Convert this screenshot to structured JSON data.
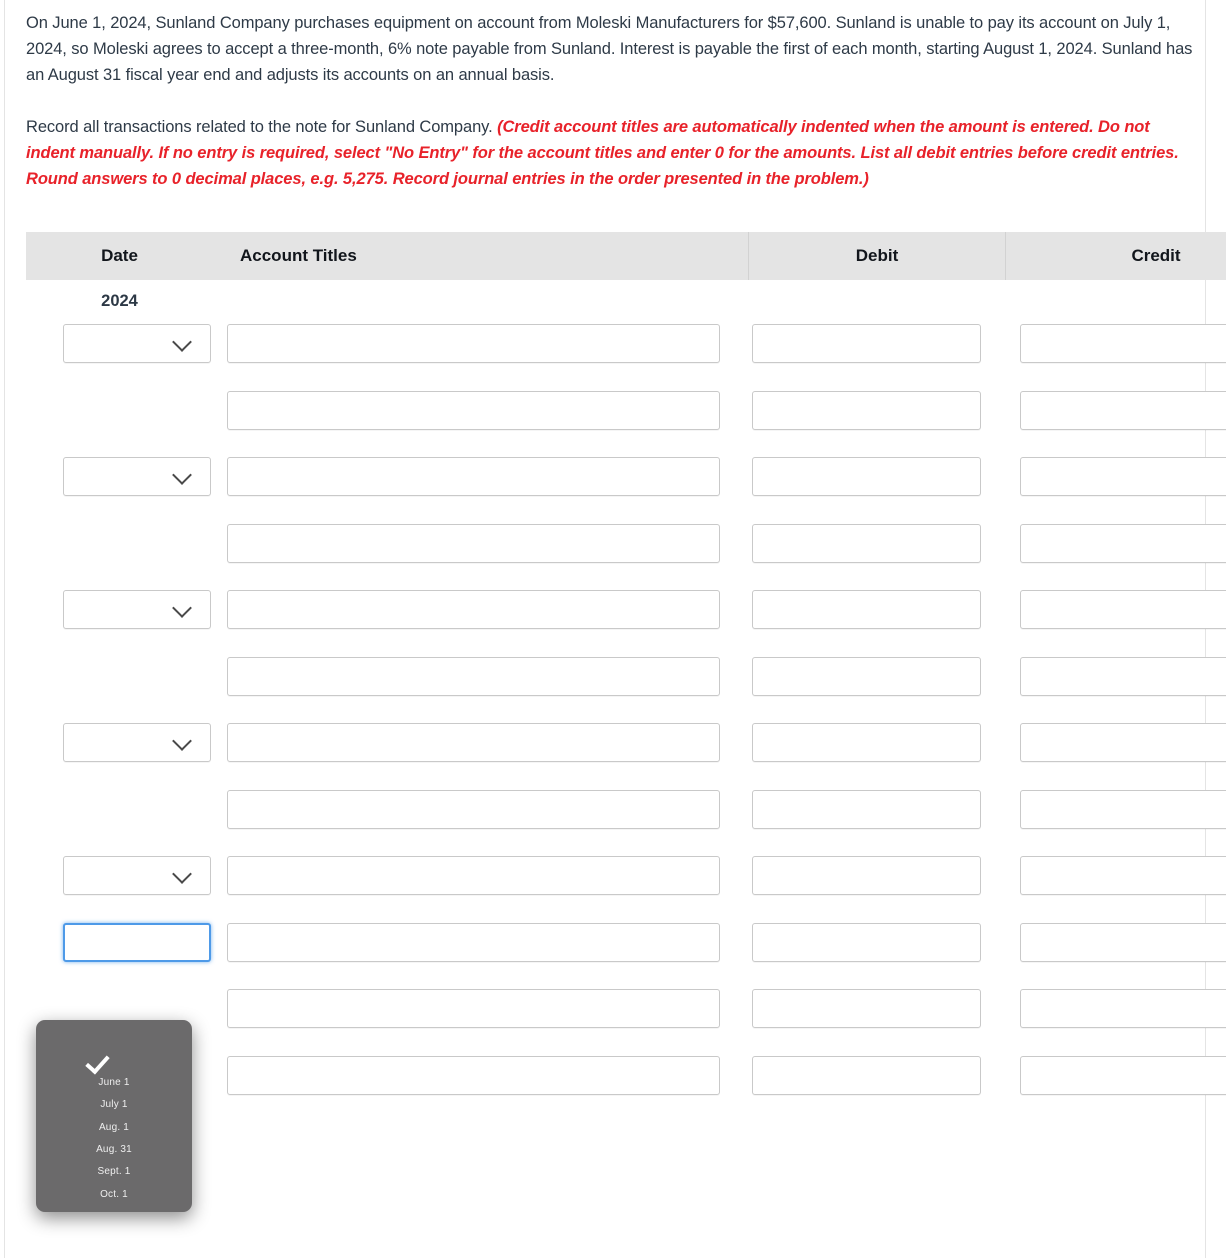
{
  "problem": {
    "paragraph1": "On June 1, 2024, Sunland Company purchases equipment on account from Moleski Manufacturers for $57,600. Sunland is unable to pay its account on July 1, 2024, so Moleski agrees to accept a three-month, 6% note payable from Sunland. Interest is payable the first of each month, starting August 1, 2024. Sunland has an August 31 fiscal year end and adjusts its accounts on an annual basis.",
    "instruction_lead": "Record all transactions related to the note for Sunland Company.",
    "instruction_red": "(Credit account titles are automatically indented when the amount is entered. Do not indent manually. If no entry is required, select \"No Entry\" for the account titles and enter 0 for the amounts. List all debit entries before credit entries. Round answers to 0 decimal places, e.g. 5,275. Record journal entries in the order presented in the problem.)",
    "red_color": "#e8222a"
  },
  "journal": {
    "headers": {
      "date": "Date",
      "account_titles": "Account Titles",
      "debit": "Debit",
      "credit": "Credit"
    },
    "header_bg": "#e4e4e4",
    "year_label": "2024",
    "date_options": [
      "",
      "June 1",
      "July 1",
      "Aug. 1",
      "Aug. 31",
      "Sept. 1",
      "Oct. 1"
    ],
    "rows": [
      {
        "has_date_select": true,
        "date_value": "",
        "account_title": "",
        "debit": "",
        "credit": ""
      },
      {
        "has_date_select": false,
        "date_value": "",
        "account_title": "",
        "debit": "",
        "credit": ""
      },
      {
        "has_date_select": true,
        "date_value": "",
        "account_title": "",
        "debit": "",
        "credit": ""
      },
      {
        "has_date_select": false,
        "date_value": "",
        "account_title": "",
        "debit": "",
        "credit": ""
      },
      {
        "has_date_select": true,
        "date_value": "",
        "account_title": "",
        "debit": "",
        "credit": ""
      },
      {
        "has_date_select": false,
        "date_value": "",
        "account_title": "",
        "debit": "",
        "credit": ""
      },
      {
        "has_date_select": true,
        "date_value": "",
        "account_title": "",
        "debit": "",
        "credit": ""
      },
      {
        "has_date_select": false,
        "date_value": "",
        "account_title": "",
        "debit": "",
        "credit": ""
      },
      {
        "has_date_select": true,
        "date_value": "",
        "account_title": "",
        "debit": "",
        "credit": ""
      },
      {
        "has_date_select": true,
        "date_value": "",
        "account_title": "",
        "debit": "",
        "credit": "",
        "date_focused": true
      },
      {
        "has_date_select": false,
        "date_value": "",
        "account_title": "",
        "debit": "",
        "credit": ""
      },
      {
        "has_date_select": false,
        "date_value": "",
        "account_title": "",
        "debit": "",
        "credit": ""
      }
    ]
  },
  "dropdown": {
    "open": true,
    "selected_index": 0,
    "background": "#6b6a6b",
    "items": [
      {
        "label": "",
        "checked": true
      },
      {
        "label": "June 1",
        "checked": false
      },
      {
        "label": "July 1",
        "checked": false
      },
      {
        "label": "Aug. 1",
        "checked": false
      },
      {
        "label": "Aug. 31",
        "checked": false
      },
      {
        "label": "Sept. 1",
        "checked": false
      },
      {
        "label": "Oct. 1",
        "checked": false
      }
    ]
  }
}
